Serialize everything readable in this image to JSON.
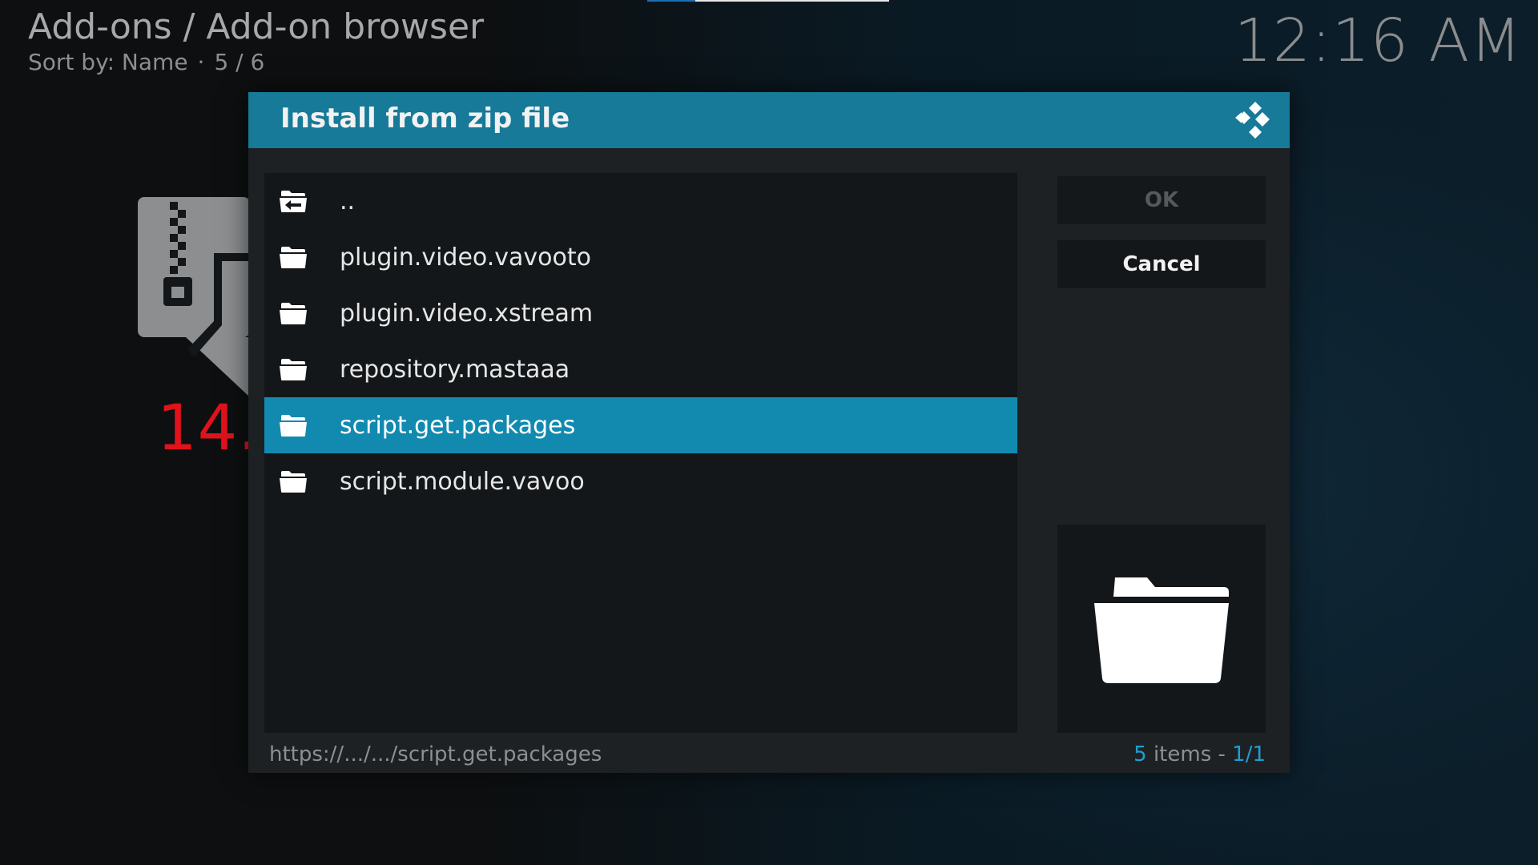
{
  "header": {
    "breadcrumb": "Add-ons / Add-on browser",
    "sort_label": "Sort by: Name",
    "sort_separator": "·",
    "position": "5 / 6"
  },
  "clock": "12:16 AM",
  "annotation": "14.",
  "dialog": {
    "title": "Install from zip file",
    "logo_icon": "kodi-logo-icon",
    "items": [
      {
        "label": "..",
        "icon": "folder-back-icon",
        "selected": false
      },
      {
        "label": "plugin.video.vavooto",
        "icon": "folder-icon",
        "selected": false
      },
      {
        "label": "plugin.video.xstream",
        "icon": "folder-icon",
        "selected": false
      },
      {
        "label": "repository.mastaaa",
        "icon": "folder-icon",
        "selected": false
      },
      {
        "label": "script.get.packages",
        "icon": "folder-icon",
        "selected": true
      },
      {
        "label": "script.module.vavoo",
        "icon": "folder-icon",
        "selected": false
      }
    ],
    "ok_label": "OK",
    "cancel_label": "Cancel",
    "footer": {
      "path": "https://.../.../script.get.packages",
      "item_count": "5",
      "items_text": " items - ",
      "page": "1/1"
    }
  },
  "colors": {
    "header_bar": "#167a98",
    "selected_row": "#128ab0",
    "annotation": "#e0121b",
    "highlight_text": "#1ba0cf"
  }
}
